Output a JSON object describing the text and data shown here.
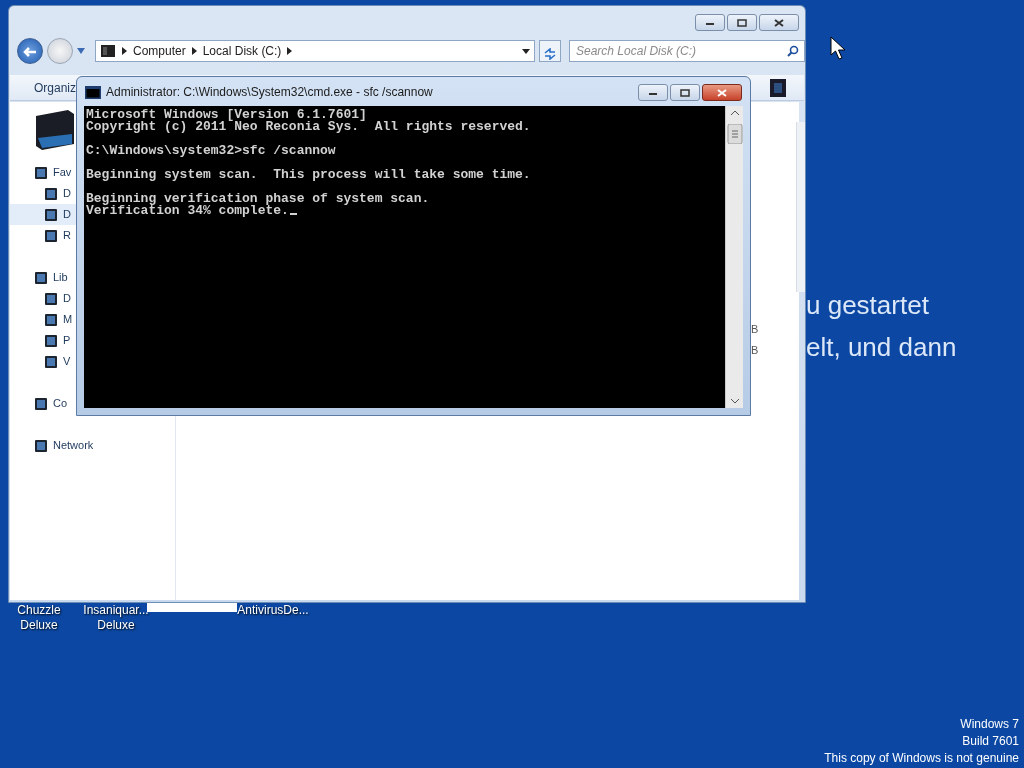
{
  "desktop": {
    "background_text": [
      "u gestartet",
      "elt, und dann"
    ],
    "icons": [
      {
        "lines": [
          "Chuzzle",
          "Deluxe"
        ]
      },
      {
        "lines": [
          "Insaniquar...",
          "Deluxe"
        ]
      },
      {
        "lines": [
          "AntivirusDe..."
        ]
      }
    ],
    "system_notice": [
      "Windows 7",
      "Build 7601",
      "This copy of Windows is not genuine"
    ]
  },
  "explorer": {
    "address": [
      "Computer",
      "Local Disk (C:)"
    ],
    "search": {
      "placeholder": "Search Local Disk (C:)"
    },
    "toolbar": [
      "Organiz"
    ],
    "sidebar": {
      "items": [
        {
          "label": "Fav",
          "selected": false,
          "children": [
            {
              "label": "D",
              "selected": false
            },
            {
              "label": "D",
              "selected": true
            },
            {
              "label": "R",
              "selected": false
            }
          ]
        },
        {
          "label": "Lib",
          "selected": false,
          "children": [
            {
              "label": "D",
              "selected": false
            },
            {
              "label": "M",
              "selected": false
            },
            {
              "label": "P",
              "selected": false
            },
            {
              "label": "V",
              "selected": false
            }
          ]
        },
        {
          "label": "Co",
          "selected": false
        },
        {
          "label": "Network",
          "selected": false
        }
      ]
    },
    "content_texts": [
      "B",
      "B"
    ]
  },
  "console": {
    "title": "Administrator: C:\\Windows\\System32\\cmd.exe - sfc  /scannow",
    "paragraphs": [
      [
        "Microsoft Windows [Version 6.1.7601]",
        "Copyright (c) 2011 Neo Reconia Sys.  All rights reserved."
      ],
      [
        "C:\\Windows\\system32>sfc /scannow"
      ],
      [
        "Beginning system scan.  This process will take some time."
      ],
      [
        "Beginning verification phase of system scan.",
        "Verification 34% complete."
      ]
    ],
    "cursor": true
  }
}
